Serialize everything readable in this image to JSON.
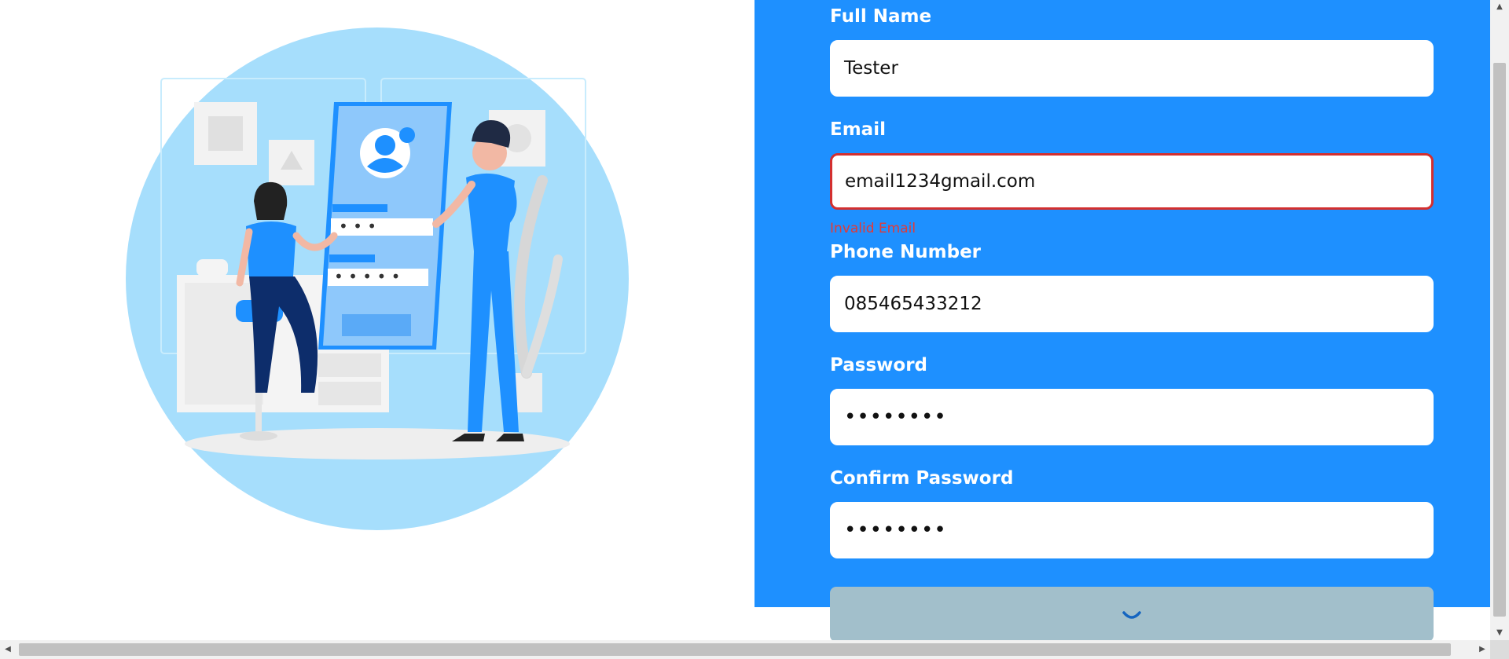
{
  "form": {
    "full_name": {
      "label": "Full Name",
      "value": "Tester"
    },
    "email": {
      "label": "Email",
      "value": "email1234gmail.com",
      "error": "Invalid Email"
    },
    "phone": {
      "label": "Phone Number",
      "value": "085465433212"
    },
    "password": {
      "label": "Password",
      "value": "••••••••"
    },
    "confirm_password": {
      "label": "Confirm Password",
      "value": "••••••••"
    },
    "submit": {
      "state": "loading",
      "spinner_icon": "loading-spinner-icon"
    }
  },
  "illustration": {
    "icon": "signup-illustration"
  },
  "colors": {
    "panel_blue": "#1e90ff",
    "error_red": "#d32f2f",
    "button_disabled": "#a2bfcb",
    "illustration_circle": "#a6defc"
  }
}
